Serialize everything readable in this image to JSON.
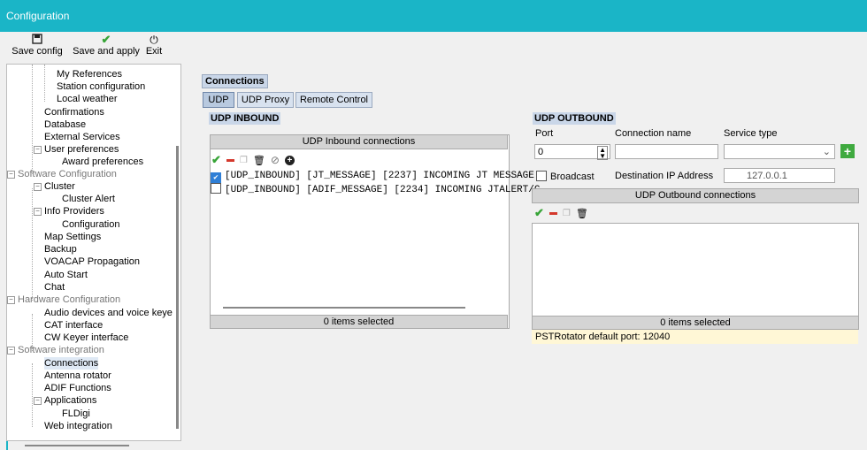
{
  "window": {
    "title": "Configuration"
  },
  "toolbar": {
    "save_config": "Save config",
    "save_and_apply": "Save and apply",
    "exit": "Exit"
  },
  "tree": {
    "items": [
      {
        "label": "My References"
      },
      {
        "label": "Station configuration"
      },
      {
        "label": "Local weather"
      },
      {
        "label": "Confirmations"
      },
      {
        "label": "Database"
      },
      {
        "label": "External Services"
      },
      {
        "label": "User preferences"
      },
      {
        "label": "Award preferences"
      },
      {
        "label": "Software Configuration"
      },
      {
        "label": "Cluster"
      },
      {
        "label": "Cluster Alert"
      },
      {
        "label": "Info Providers"
      },
      {
        "label": "Configuration"
      },
      {
        "label": "Map Settings"
      },
      {
        "label": "Backup"
      },
      {
        "label": "VOACAP Propagation"
      },
      {
        "label": "Auto Start"
      },
      {
        "label": "Chat"
      },
      {
        "label": "Hardware Configuration"
      },
      {
        "label": "Audio devices and voice keye"
      },
      {
        "label": "CAT interface"
      },
      {
        "label": "CW Keyer interface"
      },
      {
        "label": "Software integration"
      },
      {
        "label": "Connections"
      },
      {
        "label": "Antenna rotator"
      },
      {
        "label": "ADIF Functions"
      },
      {
        "label": "Applications"
      },
      {
        "label": "FLDigi"
      },
      {
        "label": "Web integration"
      }
    ]
  },
  "main": {
    "heading": "Connections",
    "tabs": [
      {
        "label": "UDP"
      },
      {
        "label": "UDP Proxy"
      },
      {
        "label": "Remote Control"
      }
    ],
    "inbound": {
      "title": "UDP INBOUND",
      "list_header": "UDP Inbound connections",
      "rows": [
        {
          "text": "[UDP_INBOUND] [JT_MESSAGE] [2237] INCOMING JT MESSAGE",
          "checked": true
        },
        {
          "text": "[UDP_INBOUND] [ADIF_MESSAGE] [2234] INCOMING JTALERT/C",
          "checked": false
        }
      ],
      "footer": "0 items selected"
    },
    "outbound": {
      "title": "UDP OUTBOUND",
      "port_label": "Port",
      "port_value": "0",
      "conn_name_label": "Connection name",
      "conn_name_value": "",
      "service_type_label": "Service type",
      "service_type_value": "",
      "broadcast_label": "Broadcast",
      "dest_ip_label": "Destination IP Address",
      "dest_ip_value": "127.0.0.1",
      "list_header": "UDP Outbound connections",
      "footer": "0 items selected",
      "note": "PSTRotator default port: 12040"
    }
  }
}
